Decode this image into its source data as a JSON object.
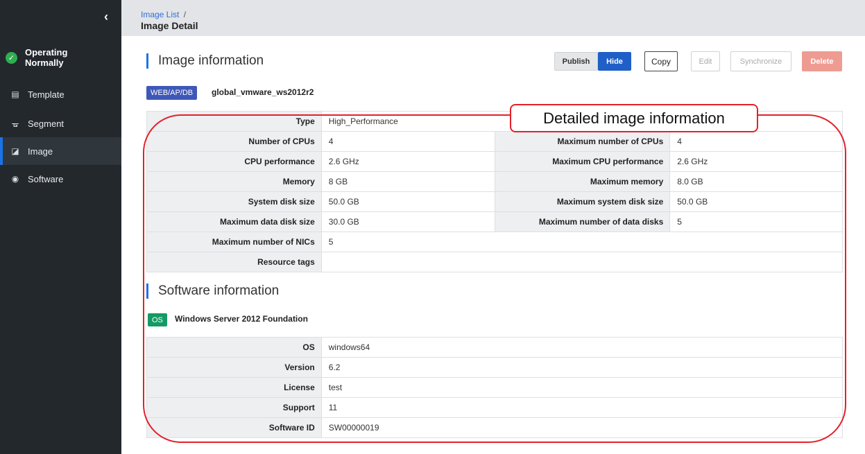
{
  "sidebar": {
    "collapse_glyph": "‹",
    "status_line1": "Operating",
    "status_line2": "Normally",
    "items": [
      {
        "label": "Template",
        "icon": "template-icon"
      },
      {
        "label": "Segment",
        "icon": "segment-icon"
      },
      {
        "label": "Image",
        "icon": "image-icon",
        "active": true
      },
      {
        "label": "Software",
        "icon": "software-icon"
      }
    ]
  },
  "header": {
    "breadcrumb_link": "Image List",
    "breadcrumb_sep": "/",
    "page_title": "Image Detail"
  },
  "image_section": {
    "title": "Image information",
    "buttons": {
      "publish": "Publish",
      "hide": "Hide",
      "copy": "Copy",
      "edit": "Edit",
      "synchronize": "Synchronize",
      "delete": "Delete"
    },
    "tag": "WEB/AP/DB",
    "image_name": "global_vmware_ws2012r2",
    "rows": {
      "type_label": "Type",
      "type_value": "High_Performance",
      "cpus_label": "Number of CPUs",
      "cpus_value": "4",
      "max_cpus_label": "Maximum number of CPUs",
      "max_cpus_value": "4",
      "cpu_perf_label": "CPU performance",
      "cpu_perf_value": "2.6 GHz",
      "max_cpu_perf_label": "Maximum CPU performance",
      "max_cpu_perf_value": "2.6 GHz",
      "memory_label": "Memory",
      "memory_value": "8 GB",
      "max_memory_label": "Maximum memory",
      "max_memory_value": "8.0 GB",
      "sys_disk_label": "System disk size",
      "sys_disk_value": "50.0 GB",
      "max_sys_disk_label": "Maximum system disk size",
      "max_sys_disk_value": "50.0 GB",
      "max_data_disk_label": "Maximum data disk size",
      "max_data_disk_value": "30.0 GB",
      "max_data_disks_label": "Maximum number of data disks",
      "max_data_disks_value": "5",
      "max_nics_label": "Maximum number of NICs",
      "max_nics_value": "5",
      "resource_tags_label": "Resource tags",
      "resource_tags_value": ""
    }
  },
  "software_section": {
    "title": "Software information",
    "tag": "OS",
    "software_name": "Windows Server 2012 Foundation",
    "rows": {
      "os_label": "OS",
      "os_value": "windows64",
      "version_label": "Version",
      "version_value": "6.2",
      "license_label": "License",
      "license_value": "test",
      "support_label": "Support",
      "support_value": "11",
      "software_id_label": "Software ID",
      "software_id_value": "SW00000019"
    }
  },
  "annotation": {
    "label": "Detailed image information",
    "color": "#e3202a"
  },
  "colors": {
    "sidebar_bg": "#23282d",
    "accent_blue": "#1a73e8",
    "ok_green": "#2eae4f",
    "delete_red": "#ee9c92"
  }
}
